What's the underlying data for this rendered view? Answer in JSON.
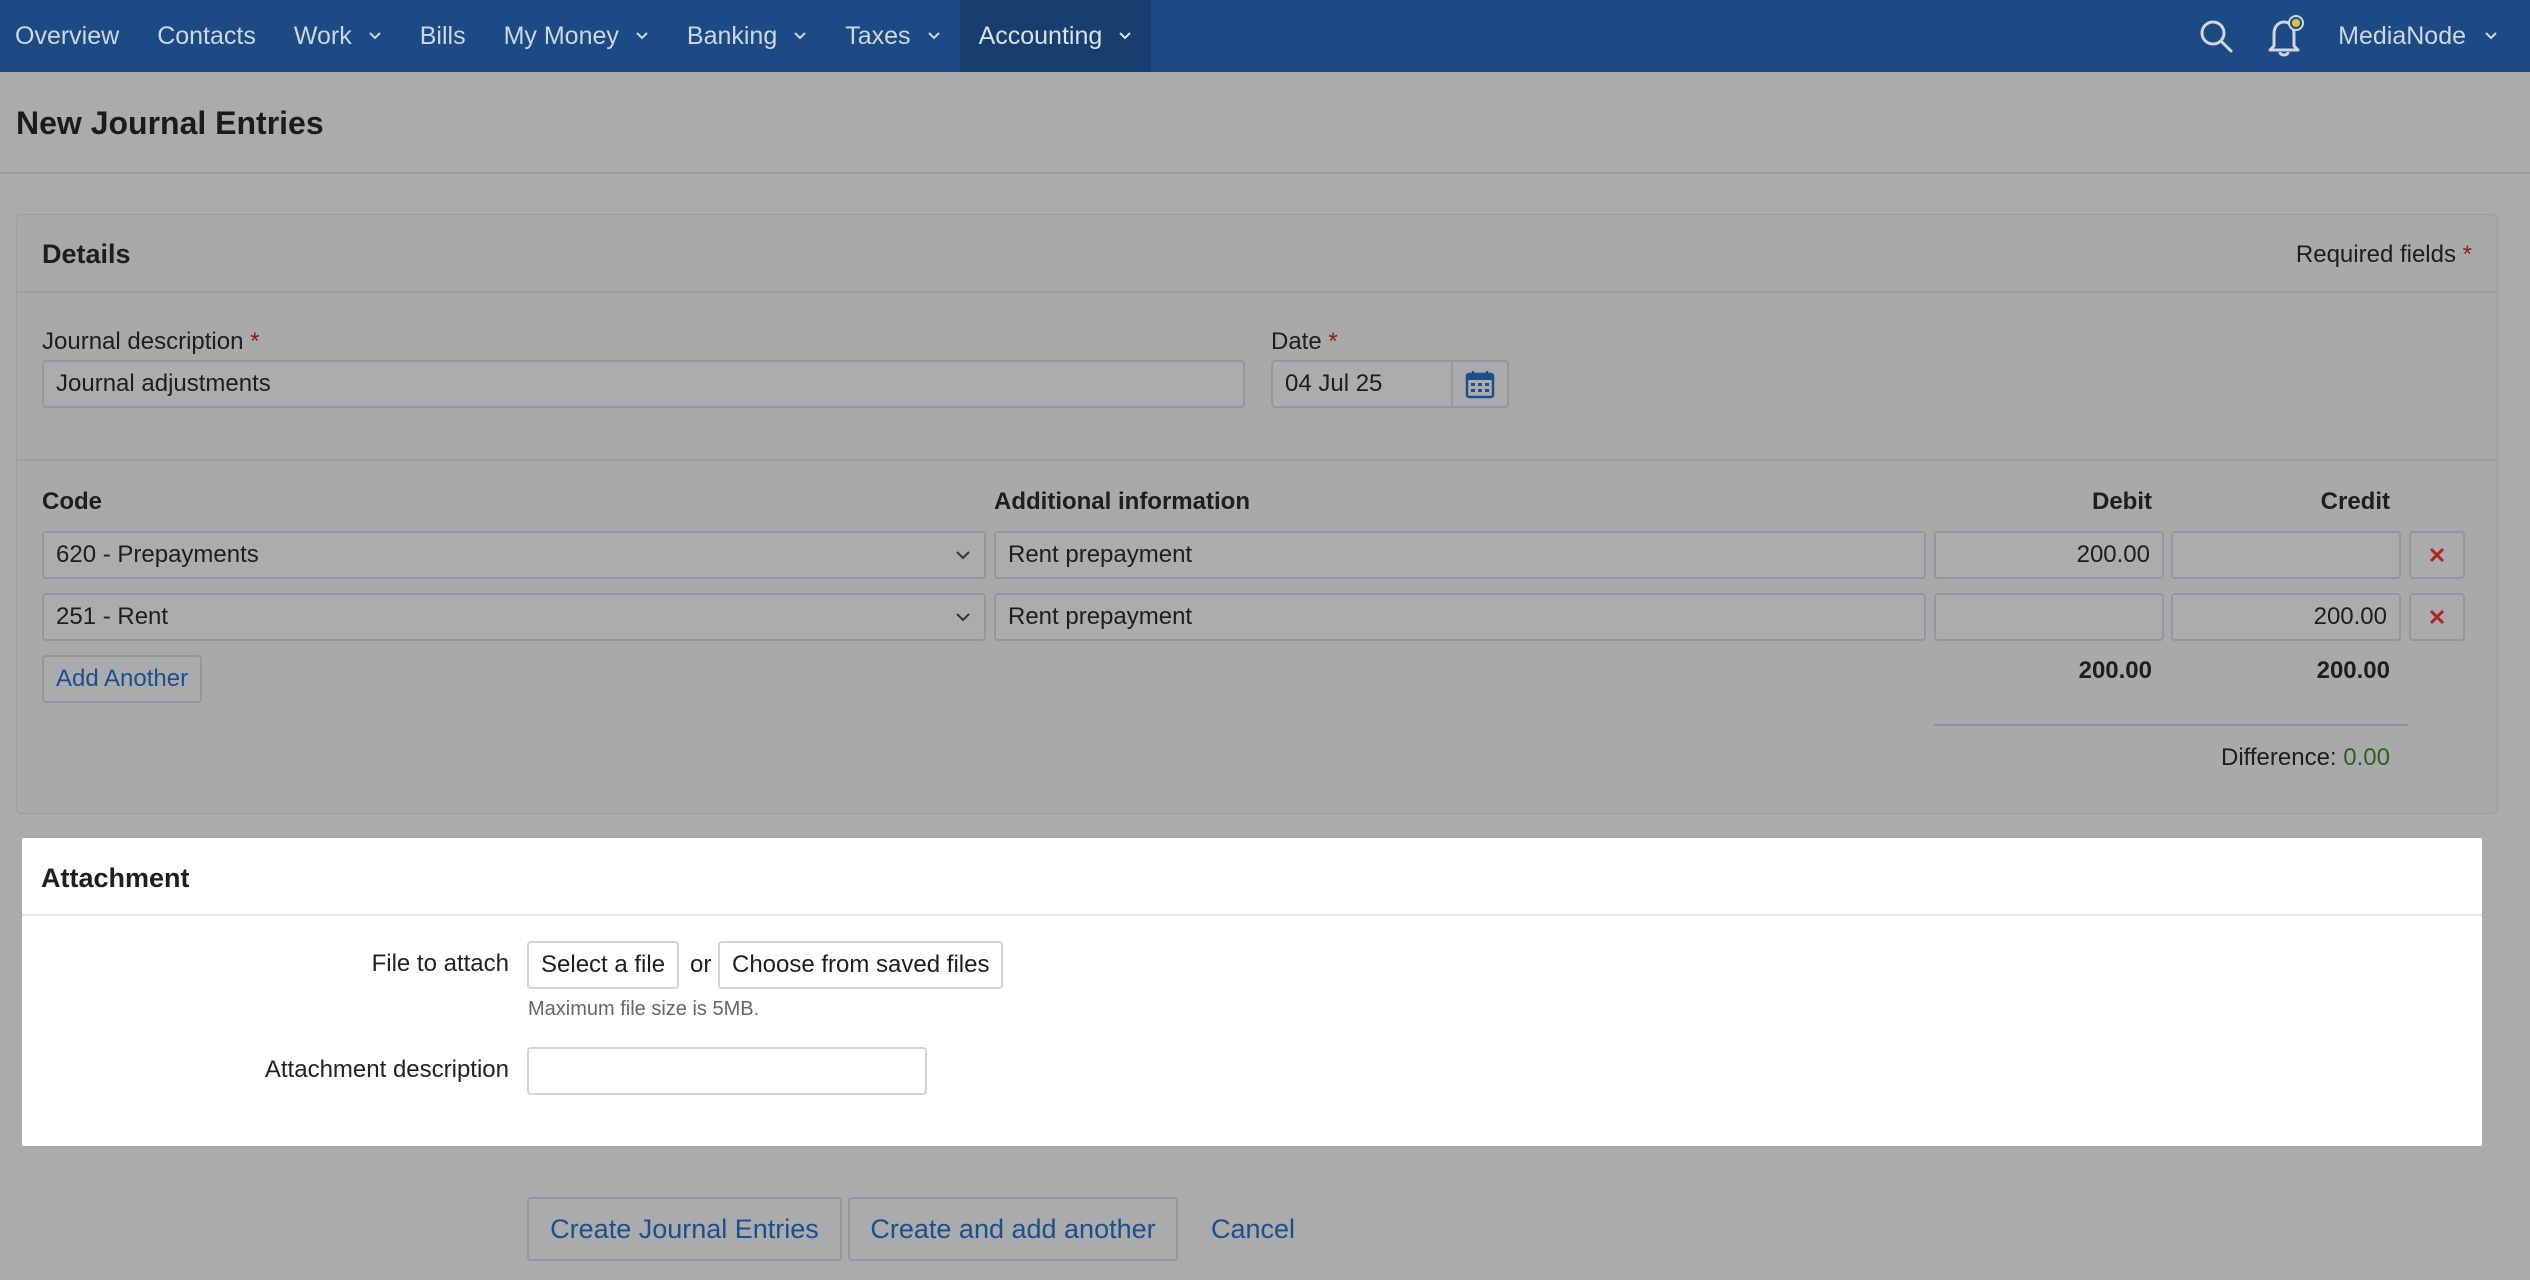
{
  "nav": {
    "items": [
      {
        "label": "Overview"
      },
      {
        "label": "Contacts"
      },
      {
        "label": "Work"
      },
      {
        "label": "Bills"
      },
      {
        "label": "My Money"
      },
      {
        "label": "Banking"
      },
      {
        "label": "Taxes"
      },
      {
        "label": "Accounting"
      }
    ],
    "active": "Accounting",
    "org_name": "MediaNode",
    "icons": [
      "search-icon",
      "notification-bell-icon"
    ]
  },
  "page": {
    "title": "New Journal Entries"
  },
  "details": {
    "title": "Details",
    "required_label": "Required fields",
    "required_marker": "*",
    "journal_description_label": "Journal description",
    "journal_description_value": "Journal adjustments",
    "date_label": "Date",
    "date_value": "04 Jul 25",
    "columns": {
      "code": "Code",
      "additional": "Additional information",
      "debit": "Debit",
      "credit": "Credit"
    },
    "lines": [
      {
        "code": "620 - Prepayments",
        "info": "Rent prepayment",
        "debit": "200.00",
        "credit": ""
      },
      {
        "code": "251 - Rent",
        "info": "Rent prepayment",
        "debit": "",
        "credit": "200.00"
      }
    ],
    "add_another_label": "Add Another",
    "total_debit": "200.00",
    "total_credit": "200.00",
    "difference_label": "Difference:",
    "difference_value": "0.00"
  },
  "attachment": {
    "title": "Attachment",
    "file_label": "File to attach",
    "select_file_label": "Select a file",
    "or_text": "or",
    "saved_files_label": "Choose from saved files",
    "max_size_hint": "Maximum file size is 5MB.",
    "description_label": "Attachment description",
    "description_value": ""
  },
  "actions": {
    "create_label": "Create Journal Entries",
    "create_add_label": "Create and add another",
    "cancel_label": "Cancel"
  },
  "colors": {
    "nav_bg": "#1c4a84",
    "link": "#1d4f8c",
    "required": "#8b1c1c",
    "delete": "#b22222",
    "difference_ok": "#2f5f1f"
  }
}
